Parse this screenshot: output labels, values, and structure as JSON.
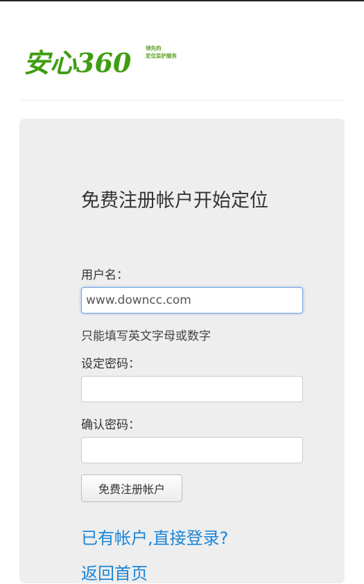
{
  "header": {
    "logo_text": "安心360",
    "tagline_line1": "领先的",
    "tagline_line2": "定位监护服务"
  },
  "form": {
    "title": "免费注册帐户开始定位",
    "username_label": "用户名：",
    "username_value": "www.downcc.com",
    "username_hint": "只能填写英文字母或数字",
    "password_label": "设定密码：",
    "password_value": "",
    "confirm_label": "确认密码：",
    "confirm_value": "",
    "submit_label": "免费注册帐户"
  },
  "links": {
    "login": "已有帐户,直接登录?",
    "home": "返回首页"
  },
  "colors": {
    "brand_green": "#3f9d12",
    "link_blue": "#1a85d6",
    "panel_bg": "#eeeeee",
    "focus_blue": "#72a7de"
  }
}
